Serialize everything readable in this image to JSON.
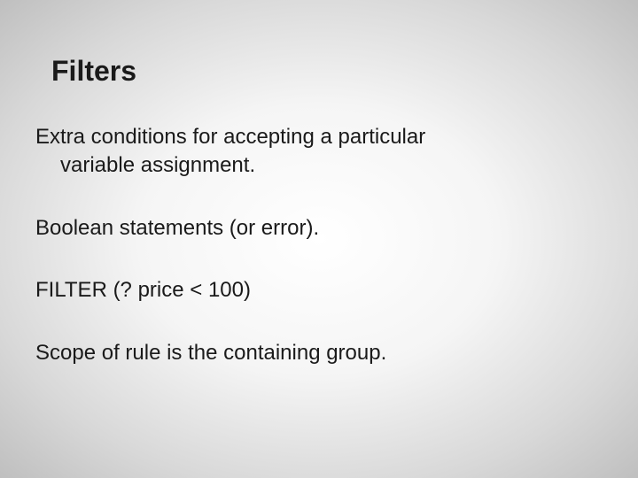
{
  "slide": {
    "title": "Filters",
    "p1_line1": "Extra conditions for accepting a particular",
    "p1_line2": "variable assignment.",
    "p2": "Boolean statements (or error).",
    "p3": "FILTER (? price < 100)",
    "p4": "Scope of rule is the containing group."
  }
}
